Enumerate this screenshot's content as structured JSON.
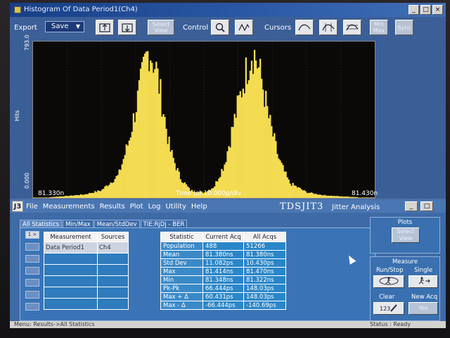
{
  "window": {
    "title": "Histogram Of Data Period1(Ch4)"
  },
  "window_buttons": [
    "_",
    "□",
    "×"
  ],
  "toolbar": {
    "export_label": "Export",
    "save_label": "Save",
    "select_view_label": "Select View",
    "control_label": "Control",
    "cursors_label": "Cursors",
    "min_max_label": "Min Max",
    "sync_label": "Sync"
  },
  "plot": {
    "y_top": "793.0",
    "y_bottom": "0.000",
    "y_label": "Hits",
    "x_left": "81.330n",
    "x_center": "Time (s)  10.000p/div",
    "x_right": "81.430n",
    "bar_color": "#f4dc52"
  },
  "chart_data": {
    "type": "bar",
    "xlabel": "Time (s)",
    "ylabel": "Hits",
    "xlim": [
      81.33,
      81.43
    ],
    "ylim": [
      0,
      793
    ],
    "x_unit": "ns",
    "series": [
      {
        "values": [
          [
            81.335,
            4
          ],
          [
            81.34,
            10
          ],
          [
            81.345,
            18
          ],
          [
            81.35,
            40
          ],
          [
            81.355,
            120
          ],
          [
            81.358,
            300
          ],
          [
            81.361,
            560
          ],
          [
            81.363,
            740
          ],
          [
            81.364,
            793
          ],
          [
            81.366,
            690
          ],
          [
            81.368,
            480
          ],
          [
            81.37,
            260
          ],
          [
            81.373,
            110
          ],
          [
            81.376,
            40
          ],
          [
            81.38,
            28
          ],
          [
            81.383,
            60
          ],
          [
            81.386,
            180
          ],
          [
            81.389,
            420
          ],
          [
            81.392,
            650
          ],
          [
            81.394,
            780
          ],
          [
            81.395,
            760
          ],
          [
            81.397,
            620
          ],
          [
            81.399,
            420
          ],
          [
            81.402,
            200
          ],
          [
            81.405,
            80
          ],
          [
            81.41,
            30
          ],
          [
            81.415,
            14
          ],
          [
            81.42,
            8
          ],
          [
            81.425,
            4
          ]
        ]
      }
    ]
  },
  "app": {
    "logo": "J3",
    "menu": [
      "File",
      "Measurements",
      "Results",
      "Plot",
      "Log",
      "Utility",
      "Help"
    ],
    "brand": "TDSJIT3",
    "brand_sub": "Jitter  Analysis",
    "win_buttons": [
      "_",
      "□"
    ]
  },
  "tabs": [
    "All Statistics",
    "Min/Max",
    "Mean/StdDev",
    "TIE:RjDj - BER"
  ],
  "side_buttons": [
    "1 >",
    "",
    "",
    "",
    "",
    "",
    ""
  ],
  "meas_table": {
    "headers": [
      "Measurement",
      "Sources"
    ],
    "rows": [
      [
        "Data Period1",
        "Ch4"
      ],
      [
        "",
        ""
      ],
      [
        "",
        ""
      ],
      [
        "",
        ""
      ],
      [
        "",
        ""
      ],
      [
        "",
        ""
      ]
    ]
  },
  "stats_table": {
    "headers": [
      "Statistic",
      "Current Acq",
      "All Acqs"
    ],
    "rows": [
      [
        "Population",
        "488",
        "51266"
      ],
      [
        "Mean",
        "81.380ns",
        "81.380ns"
      ],
      [
        "Std Dev",
        "11.082ps",
        "10.430ps"
      ],
      [
        "Max",
        "81.414ns",
        "81.470ns"
      ],
      [
        "Min",
        "81.348ns",
        "81.322ns"
      ],
      [
        "Pk-Pk",
        "66.444ps",
        "148.03ps"
      ],
      [
        "Max + Δ",
        "60.431ps",
        "148.03ps"
      ],
      [
        "Max - Δ",
        "-66.444ps",
        "-140.69ps"
      ]
    ]
  },
  "right": {
    "plots_label": "Plots",
    "select_view": "Select View",
    "measure_label": "Measure",
    "runstop_label": "Run/Stop",
    "single_label": "Single",
    "clear_label": "Clear",
    "newacq_label": "New Acq",
    "yes_label": "Yes"
  },
  "status": {
    "menu_path": "Menu: Results->All Statistics",
    "status": "Status : Ready"
  }
}
